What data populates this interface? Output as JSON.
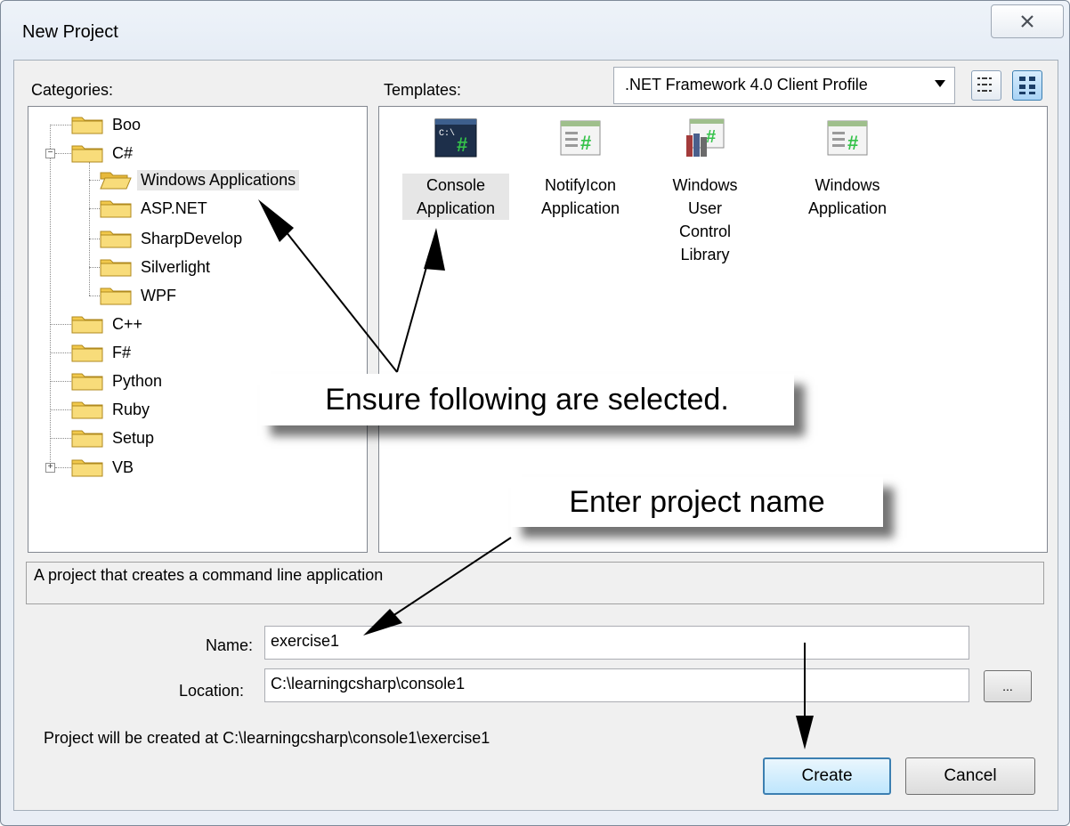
{
  "window": {
    "title": "New Project"
  },
  "categories": {
    "label": "Categories:",
    "items": [
      {
        "label": "Boo"
      },
      {
        "label": "C#"
      },
      {
        "label": "Windows Applications"
      },
      {
        "label": "ASP.NET"
      },
      {
        "label": "SharpDevelop"
      },
      {
        "label": "Silverlight"
      },
      {
        "label": "WPF"
      },
      {
        "label": "C++"
      },
      {
        "label": "F#"
      },
      {
        "label": "Python"
      },
      {
        "label": "Ruby"
      },
      {
        "label": "Setup"
      },
      {
        "label": "VB"
      }
    ],
    "selected": "Windows Applications"
  },
  "templates": {
    "label": "Templates:",
    "framework": ".NET Framework 4.0 Client Profile",
    "items": [
      {
        "line1": "Console",
        "line2": "Application",
        "icon": "console-app-icon"
      },
      {
        "line1": "NotifyIcon",
        "line2": "Application",
        "icon": "csharp-form-icon"
      },
      {
        "line1": "Windows User",
        "line2": "Control Library",
        "icon": "csharp-library-icon"
      },
      {
        "line1": "Windows",
        "line2": "Application",
        "icon": "csharp-form-icon"
      }
    ],
    "selected": "Console Application"
  },
  "description": "A project that creates a command line application",
  "form": {
    "name_label": "Name:",
    "name_value": "exercise1",
    "location_label": "Location:",
    "location_value": "C:\\learningcsharp\\console1",
    "browse_label": "...",
    "path_text": "Project will be created at C:\\learningcsharp\\console1\\exercise1"
  },
  "buttons": {
    "create": "Create",
    "cancel": "Cancel"
  },
  "annotations": {
    "callout1": "Ensure following are selected.",
    "callout2": "Enter project name"
  },
  "colors": {
    "selection_blue": "#3c7fb1",
    "folder_yellow": "#f2c94c"
  }
}
